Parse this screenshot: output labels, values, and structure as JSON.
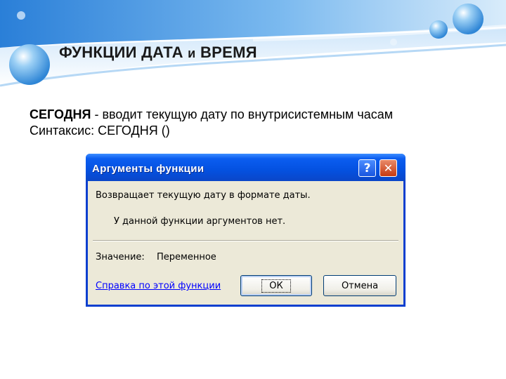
{
  "slide": {
    "title_main": "ФУНКЦИИ  ДАТА ",
    "title_small": "и",
    "title_end": " ВРЕМЯ",
    "line1_term": "СЕГОДНЯ",
    "line1_rest": " - вводит текущую дату по внутрисистемным часам",
    "line2": "Синтаксис: СЕГОДНЯ ()"
  },
  "dialog": {
    "title": "Аргументы функции",
    "help_glyph": "?",
    "close_glyph": "✕",
    "description": "Возвращает текущую дату в формате даты.",
    "no_args": "У данной функции аргументов нет.",
    "result_label": "Значение:",
    "result_value": "Переменное",
    "help_link": "Справка по этой функции",
    "ok_label": "ОК",
    "cancel_label": "Отмена"
  },
  "colors": {
    "titlebar": "#0451e0",
    "dialog_bg": "#ece9d8",
    "link": "#0000ff",
    "header_blue": "#3b8ee0"
  }
}
